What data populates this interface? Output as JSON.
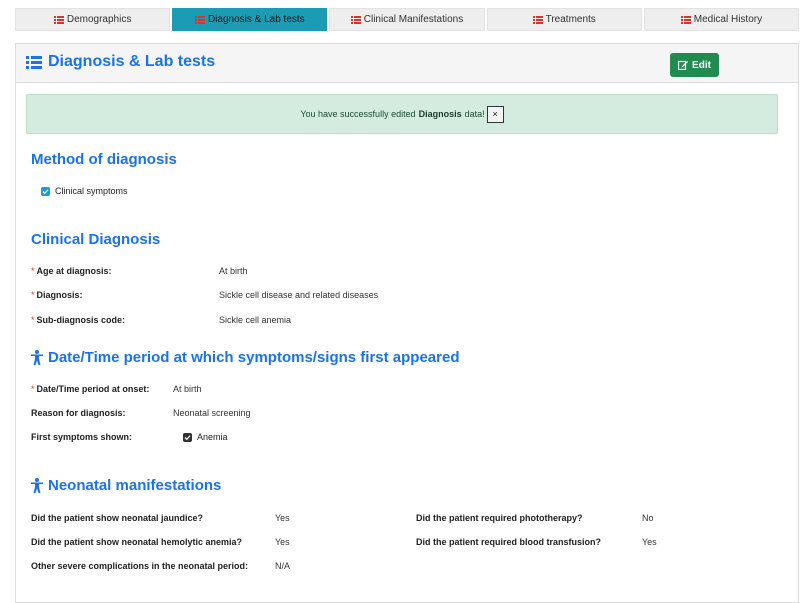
{
  "tabs": [
    {
      "label": "Demographics",
      "icon": "list-icon"
    },
    {
      "label": "Diagnosis & Lab tests",
      "icon": "list-icon",
      "active": true
    },
    {
      "label": "Clinical Manifestations",
      "icon": "list-icon"
    },
    {
      "label": "Treatments",
      "icon": "list-icon"
    },
    {
      "label": "Medical History",
      "icon": "list-icon"
    }
  ],
  "panel": {
    "title": "Diagnosis & Lab tests",
    "edit_label": "Edit"
  },
  "alert": {
    "prefix": "You have successfully edited",
    "bold": "Diagnosis",
    "suffix": "data!",
    "close_label": "×"
  },
  "method": {
    "heading": "Method of diagnosis",
    "checkbox_label": "Clinical symptoms"
  },
  "clinical": {
    "heading": "Clinical Diagnosis",
    "fields": [
      {
        "label": "Age at diagnosis:",
        "value": "At birth"
      },
      {
        "label": "Diagnosis:",
        "value": "Sickle cell disease and related diseases"
      },
      {
        "label": "Sub-diagnosis code:",
        "value": "Sickle cell anemia"
      }
    ]
  },
  "onset": {
    "heading": "Date/Time period at which symptoms/signs first appeared",
    "onset_label": "Date/Time period at onset:",
    "onset_value": "At birth",
    "reason_label": "Reason for diagnosis:",
    "reason_value": "Neonatal screening",
    "symptoms_label": "First symptoms shown:",
    "symptoms_value": "Anemia"
  },
  "neonatal": {
    "heading": "Neonatal manifestations",
    "left": [
      {
        "label": "Did the patient show neonatal jaundice?",
        "value": "Yes"
      },
      {
        "label": "Did the patient show neonatal hemolytic anemia?",
        "value": "Yes"
      },
      {
        "label": "Other severe complications in the neonatal period:",
        "value": "N/A"
      }
    ],
    "right": [
      {
        "label": "Did the patient required phototherapy?",
        "value": "No"
      },
      {
        "label": "Did the patient required blood transfusion?",
        "value": "Yes"
      }
    ]
  },
  "colors": {
    "accent": "#1a73e8",
    "active_tab": "#1b9cb4",
    "edit_button": "#218c4f",
    "alert_bg": "#d4ece0",
    "required": "#d33333"
  }
}
